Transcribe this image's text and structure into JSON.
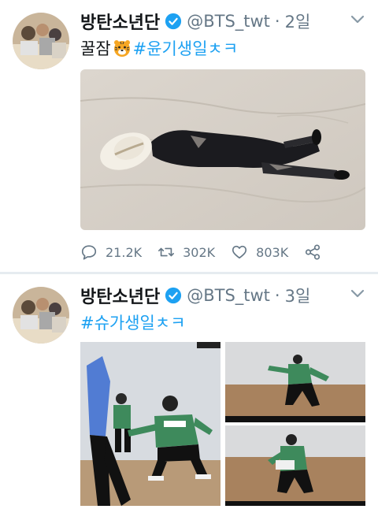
{
  "tweets": [
    {
      "name": "방탄소년단",
      "handle": "@BTS_twt",
      "separator": "·",
      "time": "2일",
      "text_prefix": "꿀잠",
      "emoji": "tiger-face-icon",
      "hashtag": "#윤기생일ㅊㅋ",
      "replies": "21.2K",
      "retweets": "302K",
      "likes": "803K"
    },
    {
      "name": "방탄소년단",
      "handle": "@BTS_twt",
      "separator": "·",
      "time": "3일",
      "hashtag": "#슈가생일ㅊㅋ"
    }
  ],
  "colors": {
    "accent": "#1da1f2",
    "muted": "#657786",
    "text": "#14171a",
    "divider": "#e6ecf0"
  }
}
